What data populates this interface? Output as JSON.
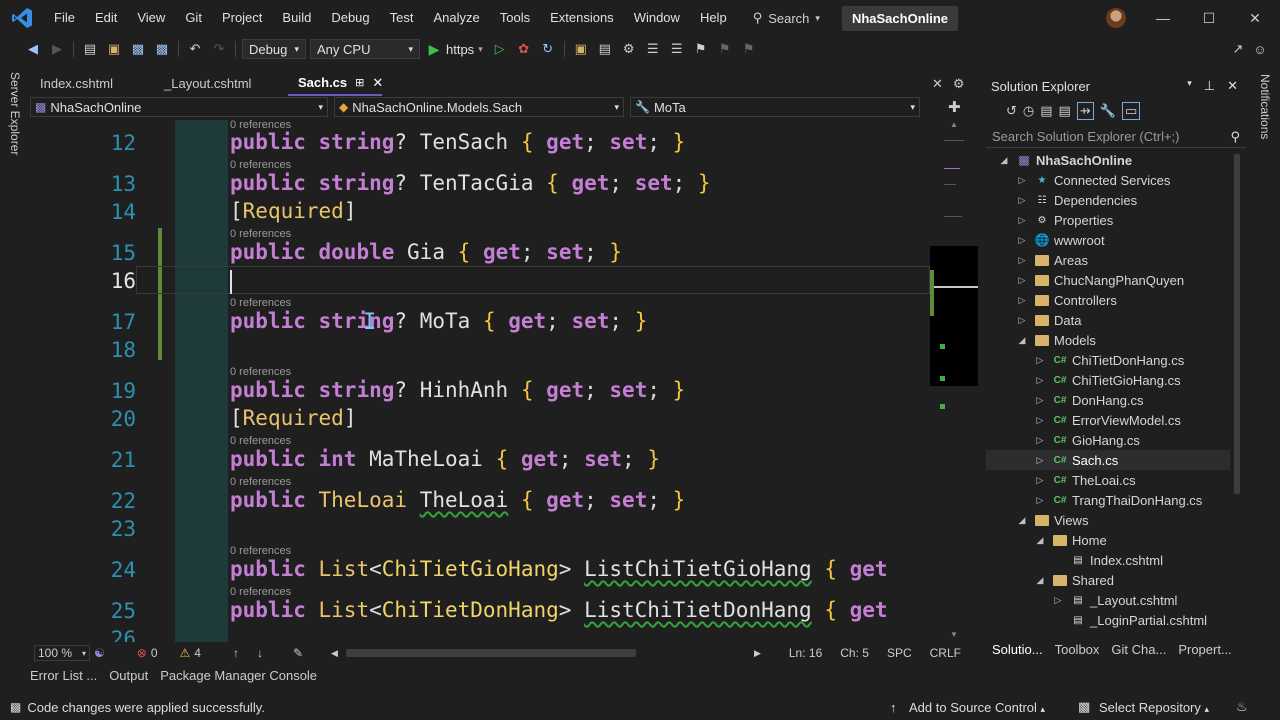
{
  "menubar": {
    "items": [
      "File",
      "Edit",
      "View",
      "Git",
      "Project",
      "Build",
      "Debug",
      "Test",
      "Analyze",
      "Tools",
      "Extensions",
      "Window",
      "Help"
    ],
    "search_label": "Search",
    "solution_name": "NhaSachOnline"
  },
  "toolbar": {
    "config": "Debug",
    "platform": "Any CPU",
    "run_label": "https"
  },
  "side_labels": {
    "left": "Server Explorer",
    "right": "Notifications"
  },
  "tabs": [
    {
      "label": "Index.cshtml",
      "active": false
    },
    {
      "label": "_Layout.cshtml",
      "active": false
    },
    {
      "label": "Sach.cs",
      "active": true
    }
  ],
  "navbar": {
    "project": "NhaSachOnline",
    "class": "NhaSachOnline.Models.Sach",
    "member": "MoTa"
  },
  "editor": {
    "refs_label": "0 references",
    "lines": [
      {
        "n": "12",
        "refs": true
      },
      {
        "n": "13",
        "refs": true
      },
      {
        "n": "14",
        "refs": false
      },
      {
        "n": "15",
        "refs": true
      },
      {
        "n": "16",
        "refs": false
      },
      {
        "n": "17",
        "refs": true
      },
      {
        "n": "18",
        "refs": false
      },
      {
        "n": "19",
        "refs": true
      },
      {
        "n": "20",
        "refs": false
      },
      {
        "n": "21",
        "refs": true
      },
      {
        "n": "22",
        "refs": true
      },
      {
        "n": "23",
        "refs": false
      },
      {
        "n": "24",
        "refs": true
      },
      {
        "n": "25",
        "refs": true
      },
      {
        "n": "26",
        "refs": false
      }
    ]
  },
  "editor_status": {
    "zoom": "100 %",
    "errors": "0",
    "warnings": "4",
    "ln": "Ln: 16",
    "ch": "Ch: 5",
    "indent": "SPC",
    "eol": "CRLF"
  },
  "bottom_tabs": [
    "Error List ...",
    "Output",
    "Package Manager Console"
  ],
  "status": {
    "message": "Code changes were applied successfully.",
    "source_control": "Add to Source Control",
    "repo": "Select Repository"
  },
  "solution_explorer": {
    "title": "Solution Explorer",
    "search_placeholder": "Search Solution Explorer (Ctrl+;)",
    "items": [
      {
        "label": "NhaSachOnline",
        "depth": 0,
        "kind": "project",
        "exp": "open",
        "bold": true
      },
      {
        "label": "Connected Services",
        "depth": 1,
        "kind": "services",
        "exp": "closed"
      },
      {
        "label": "Dependencies",
        "depth": 1,
        "kind": "deps",
        "exp": "closed"
      },
      {
        "label": "Properties",
        "depth": 1,
        "kind": "props",
        "exp": "closed"
      },
      {
        "label": "wwwroot",
        "depth": 1,
        "kind": "globe",
        "exp": "closed"
      },
      {
        "label": "Areas",
        "depth": 1,
        "kind": "folder",
        "exp": "closed"
      },
      {
        "label": "ChucNangPhanQuyen",
        "depth": 1,
        "kind": "folder",
        "exp": "closed"
      },
      {
        "label": "Controllers",
        "depth": 1,
        "kind": "folder",
        "exp": "closed"
      },
      {
        "label": "Data",
        "depth": 1,
        "kind": "folder",
        "exp": "closed"
      },
      {
        "label": "Models",
        "depth": 1,
        "kind": "folder",
        "exp": "open"
      },
      {
        "label": "ChiTietDonHang.cs",
        "depth": 2,
        "kind": "cs",
        "exp": "closed"
      },
      {
        "label": "ChiTietGioHang.cs",
        "depth": 2,
        "kind": "cs",
        "exp": "closed"
      },
      {
        "label": "DonHang.cs",
        "depth": 2,
        "kind": "cs",
        "exp": "closed"
      },
      {
        "label": "ErrorViewModel.cs",
        "depth": 2,
        "kind": "cs",
        "exp": "closed"
      },
      {
        "label": "GioHang.cs",
        "depth": 2,
        "kind": "cs",
        "exp": "closed"
      },
      {
        "label": "Sach.cs",
        "depth": 2,
        "kind": "cs",
        "exp": "closed",
        "selected": true
      },
      {
        "label": "TheLoai.cs",
        "depth": 2,
        "kind": "cs",
        "exp": "closed"
      },
      {
        "label": "TrangThaiDonHang.cs",
        "depth": 2,
        "kind": "cs",
        "exp": "closed"
      },
      {
        "label": "Views",
        "depth": 1,
        "kind": "folder",
        "exp": "open"
      },
      {
        "label": "Home",
        "depth": 2,
        "kind": "folder",
        "exp": "open"
      },
      {
        "label": "Index.cshtml",
        "depth": 3,
        "kind": "cshtml",
        "exp": "none"
      },
      {
        "label": "Shared",
        "depth": 2,
        "kind": "folder",
        "exp": "open"
      },
      {
        "label": "_Layout.cshtml",
        "depth": 3,
        "kind": "cshtml",
        "exp": "closed"
      },
      {
        "label": "_LoginPartial.cshtml",
        "depth": 3,
        "kind": "cshtml",
        "exp": "none"
      }
    ],
    "bottom_tabs": [
      "Solutio...",
      "Toolbox",
      "Git Cha...",
      "Propert..."
    ]
  },
  "colors": {
    "keyword": "#c47fd5",
    "line_number": "#2b91af",
    "accent": "#6b5bbd"
  }
}
